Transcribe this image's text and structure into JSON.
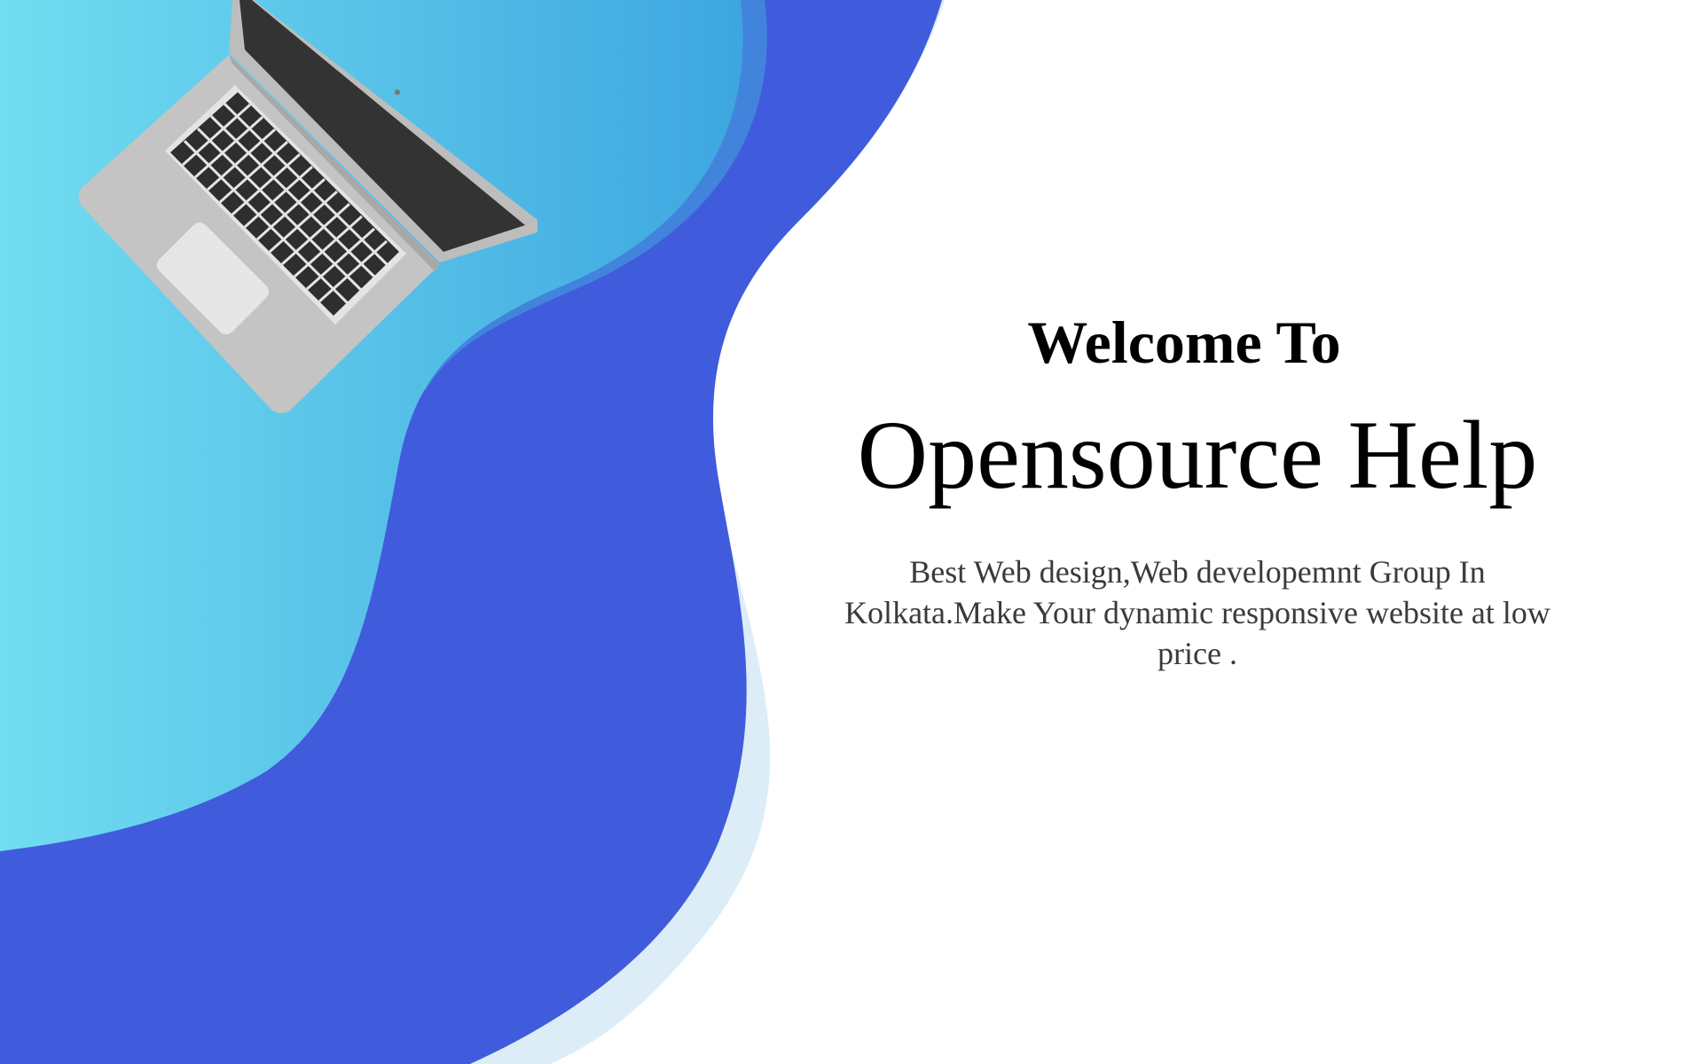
{
  "hero": {
    "welcome": "Welcome To",
    "brand": "Opensource Help",
    "tagline": "Best Web design,Web developemnt Group In Kolkata.Make Your dynamic responsive website at low price ."
  },
  "colors": {
    "light_cyan": "#6fdcf0",
    "sky_blue": "#3fa8e0",
    "royal_blue": "#405cdc",
    "pale_blue_edge": "#dcedf8",
    "laptop_silver": "#c4c4c4",
    "laptop_screen": "#333333"
  },
  "icons": {
    "laptop": "laptop-illustration"
  }
}
